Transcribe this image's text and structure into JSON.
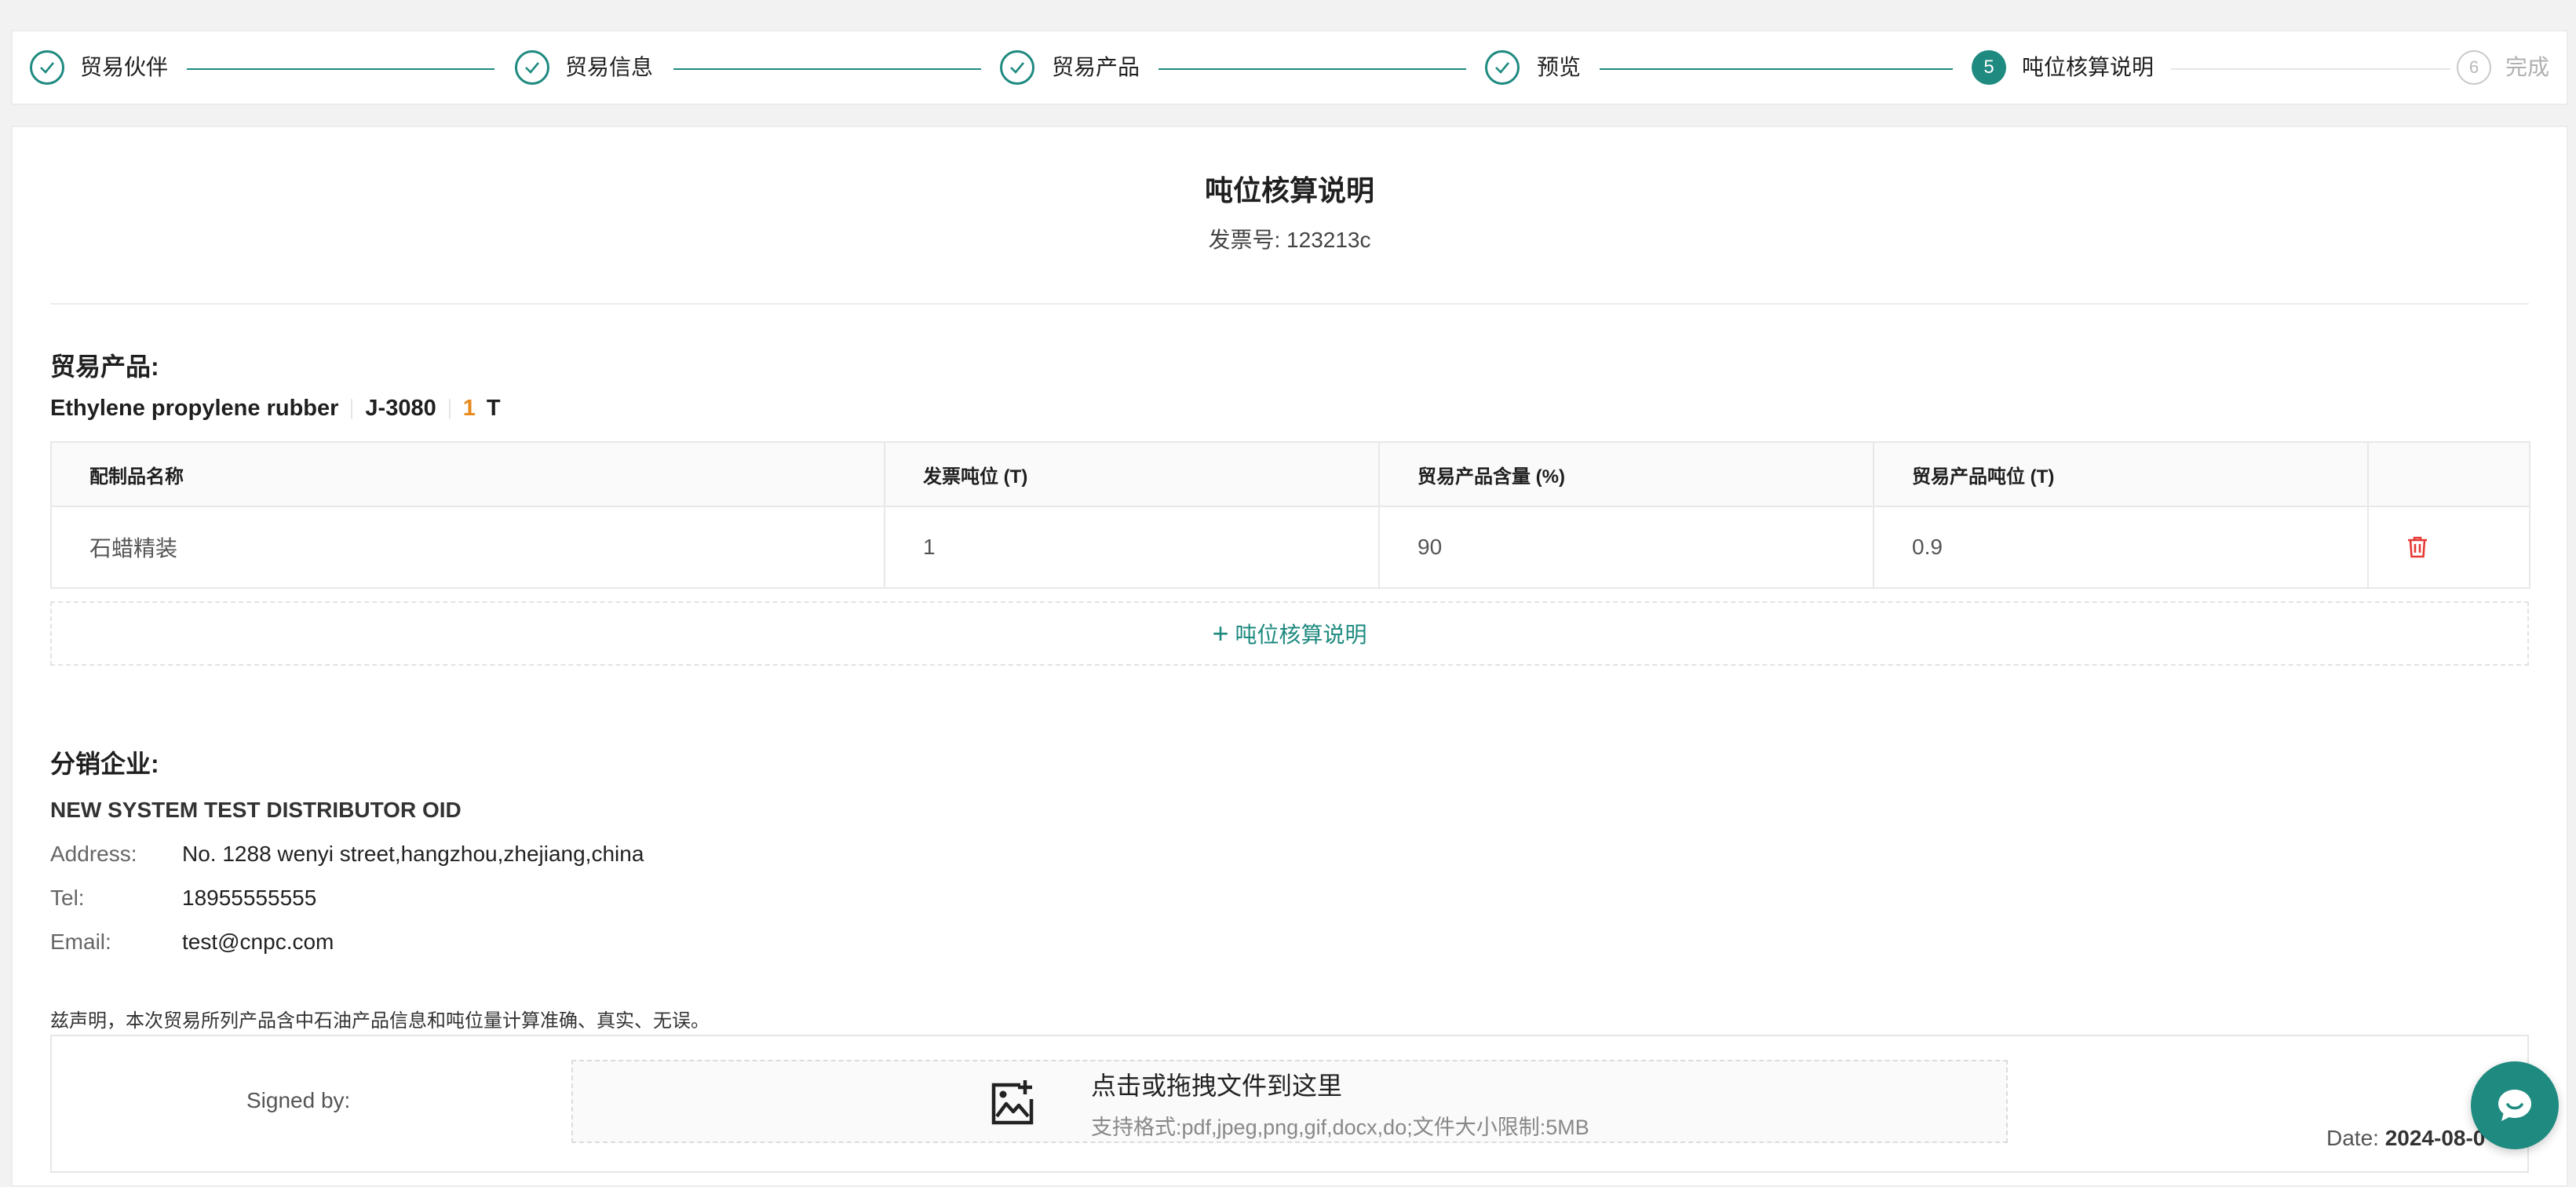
{
  "steps": [
    {
      "label": "贸易伙伴",
      "state": "done"
    },
    {
      "label": "贸易信息",
      "state": "done"
    },
    {
      "label": "贸易产品",
      "state": "done"
    },
    {
      "label": "预览",
      "state": "done"
    },
    {
      "label": "吨位核算说明",
      "state": "active",
      "number": "5"
    },
    {
      "label": "完成",
      "state": "todo",
      "number": "6"
    }
  ],
  "document": {
    "title": "吨位核算说明",
    "invoice": "发票号: 123213c"
  },
  "trade_product": {
    "heading": "贸易产品:",
    "name": "Ethylene propylene rubber",
    "code": "J-3080",
    "quantity": "1",
    "unit": "T"
  },
  "table": {
    "headers": [
      "配制品名称",
      "发票吨位 (T)",
      "贸易产品含量 (%)",
      "贸易产品吨位 (T)",
      ""
    ],
    "rows": [
      [
        "石蜡精装",
        "1",
        "90",
        "0.9"
      ]
    ]
  },
  "add_button": {
    "label": "吨位核算说明"
  },
  "distributor": {
    "heading": "分销企业:",
    "name": "NEW SYSTEM TEST DISTRIBUTOR OID",
    "address_label": "Address:",
    "address": "No. 1288 wenyi street,hangzhou,zhejiang,china",
    "tel_label": "Tel:",
    "tel": "18955555555",
    "email_label": "Email:",
    "email": "test@cnpc.com"
  },
  "declaration": "兹声明，本次贸易所列产品含中石油产品信息和吨位量计算准确、真实、无误。",
  "signature": {
    "signed_by_label": "Signed by:",
    "upload_main": "点击或拖拽文件到这里",
    "upload_sub": "支持格式:pdf,jpeg,png,gif,docx,do;文件大小限制:5MB",
    "date_label": "Date:",
    "date_value": "2024-08-0"
  },
  "colors": {
    "primary": "#1e8a80",
    "accent": "#e8891a",
    "danger": "#e53935"
  }
}
